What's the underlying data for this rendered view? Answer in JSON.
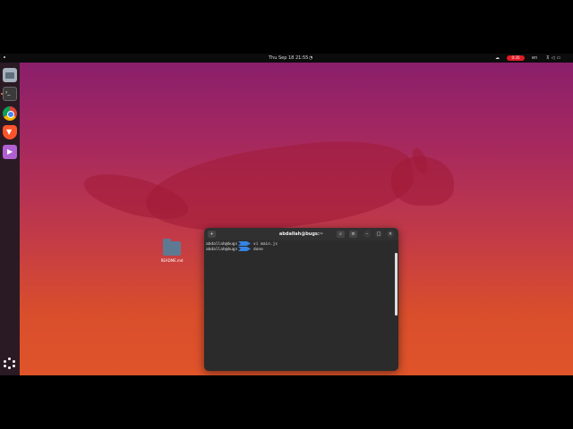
{
  "topbar": {
    "clock": "Thu Sep 18  21:55",
    "recording_badge": "0:35",
    "lang": "en",
    "icons": [
      "notification-bell-icon",
      "network-icon",
      "volume-icon",
      "power-icon"
    ]
  },
  "dock": {
    "items": [
      "files",
      "terminal",
      "chrome",
      "brave",
      "video-player"
    ],
    "show_apps": "show-apps-grid"
  },
  "desktop": {
    "file_label": "README.md"
  },
  "terminal": {
    "title": "abdallah@bugs:~",
    "lines": [
      {
        "prompt": "abdallah@bugs",
        "command": "vi main.js"
      },
      {
        "prompt": "abdallah@bugs",
        "command": "done"
      }
    ],
    "buttons": {
      "new_tab": "+",
      "search": "⌕",
      "menu": "≡",
      "minimize": "–",
      "maximize": "□",
      "close": "×"
    }
  },
  "colors": {
    "accent": "#3584e4",
    "wallpaper_top": "#8a1f6b",
    "wallpaper_bottom": "#e0542a",
    "rec_badge": "#e01b24"
  }
}
